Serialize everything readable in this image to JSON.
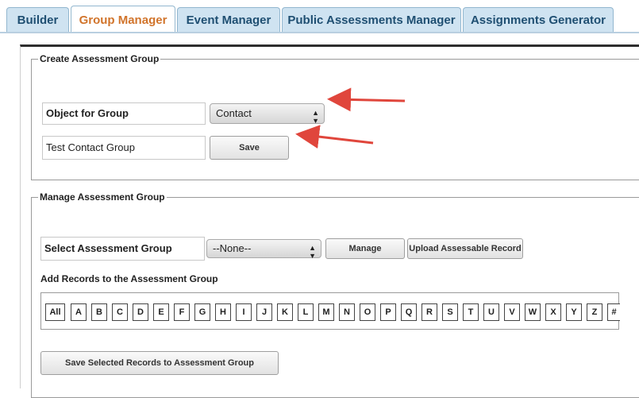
{
  "tabs": [
    {
      "label": "Builder",
      "active": false
    },
    {
      "label": "Group Manager",
      "active": true
    },
    {
      "label": "Event Manager",
      "active": false
    },
    {
      "label": "Public Assessments Manager",
      "active": false
    },
    {
      "label": "Assignments Generator",
      "active": false
    }
  ],
  "create_group": {
    "legend": "Create Assessment Group",
    "object_label": "Object for Group",
    "object_select_value": "Contact",
    "group_name_value": "Test Contact Group",
    "save_label": "Save"
  },
  "manage_group": {
    "legend": "Manage Assessment Group",
    "select_label": "Select Assessment Group",
    "select_value": "--None--",
    "manage_label": "Manage",
    "upload_label": "Upload Assessable Record",
    "add_records_label": "Add Records to the Assessment Group",
    "letters": [
      "All",
      "A",
      "B",
      "C",
      "D",
      "E",
      "F",
      "G",
      "H",
      "I",
      "J",
      "K",
      "L",
      "M",
      "N",
      "O",
      "P",
      "Q",
      "R",
      "S",
      "T",
      "U",
      "V",
      "W",
      "X",
      "Y",
      "Z",
      "#"
    ],
    "save_selected_label": "Save Selected Records to Assessment Group"
  },
  "colors": {
    "tab_bg": "#cfe3f1",
    "tab_text": "#1f4f72",
    "active_tab_text": "#d1742b",
    "annotation_arrow": "#e0463c"
  },
  "icons": {
    "select_caret": "up-down-caret-icon",
    "annotation": "red-arrow-icon"
  }
}
